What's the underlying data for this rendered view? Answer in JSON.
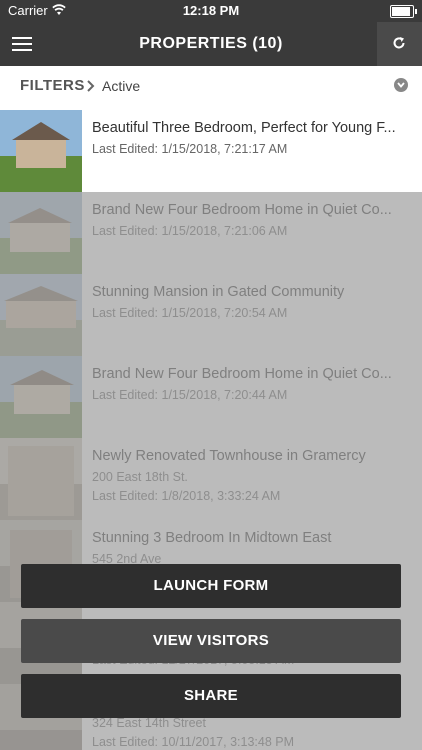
{
  "status_bar": {
    "carrier": "Carrier",
    "time": "12:18 PM"
  },
  "navbar": {
    "title": "PROPERTIES (10)",
    "menu_icon": "hamburger-icon",
    "refresh_icon": "refresh-icon"
  },
  "filters": {
    "label": "FILTERS",
    "value": "Active"
  },
  "properties": [
    {
      "name": "Beautiful Three Bedroom, Perfect for Young F...",
      "address": "",
      "edited": "Last Edited: 1/15/2018, 7:21:17 AM"
    },
    {
      "name": "Brand New Four Bedroom Home in Quiet Co...",
      "address": "",
      "edited": "Last Edited: 1/15/2018, 7:21:06 AM"
    },
    {
      "name": "Stunning Mansion in Gated Community",
      "address": "",
      "edited": "Last Edited: 1/15/2018, 7:20:54 AM"
    },
    {
      "name": "Brand New Four Bedroom Home in Quiet Co...",
      "address": "",
      "edited": "Last Edited: 1/15/2018, 7:20:44 AM"
    },
    {
      "name": "Newly Renovated Townhouse in Gramercy",
      "address": "200 East 18th St.",
      "edited": "Last Edited: 1/8/2018, 3:33:24 AM"
    },
    {
      "name": "Stunning 3 Bedroom In Midtown East",
      "address": "545 2nd Ave",
      "edited": ""
    },
    {
      "name": "",
      "address": "",
      "edited": "Last Edited: 12/27/2017, 5:05:15 AM"
    },
    {
      "name": "",
      "address": "324 East 14th Street",
      "edited": "Last Edited: 10/11/2017, 3:13:48 PM"
    }
  ],
  "actions": {
    "launch_form": "LAUNCH FORM",
    "view_visitors": "VIEW VISITORS",
    "share": "SHARE"
  }
}
